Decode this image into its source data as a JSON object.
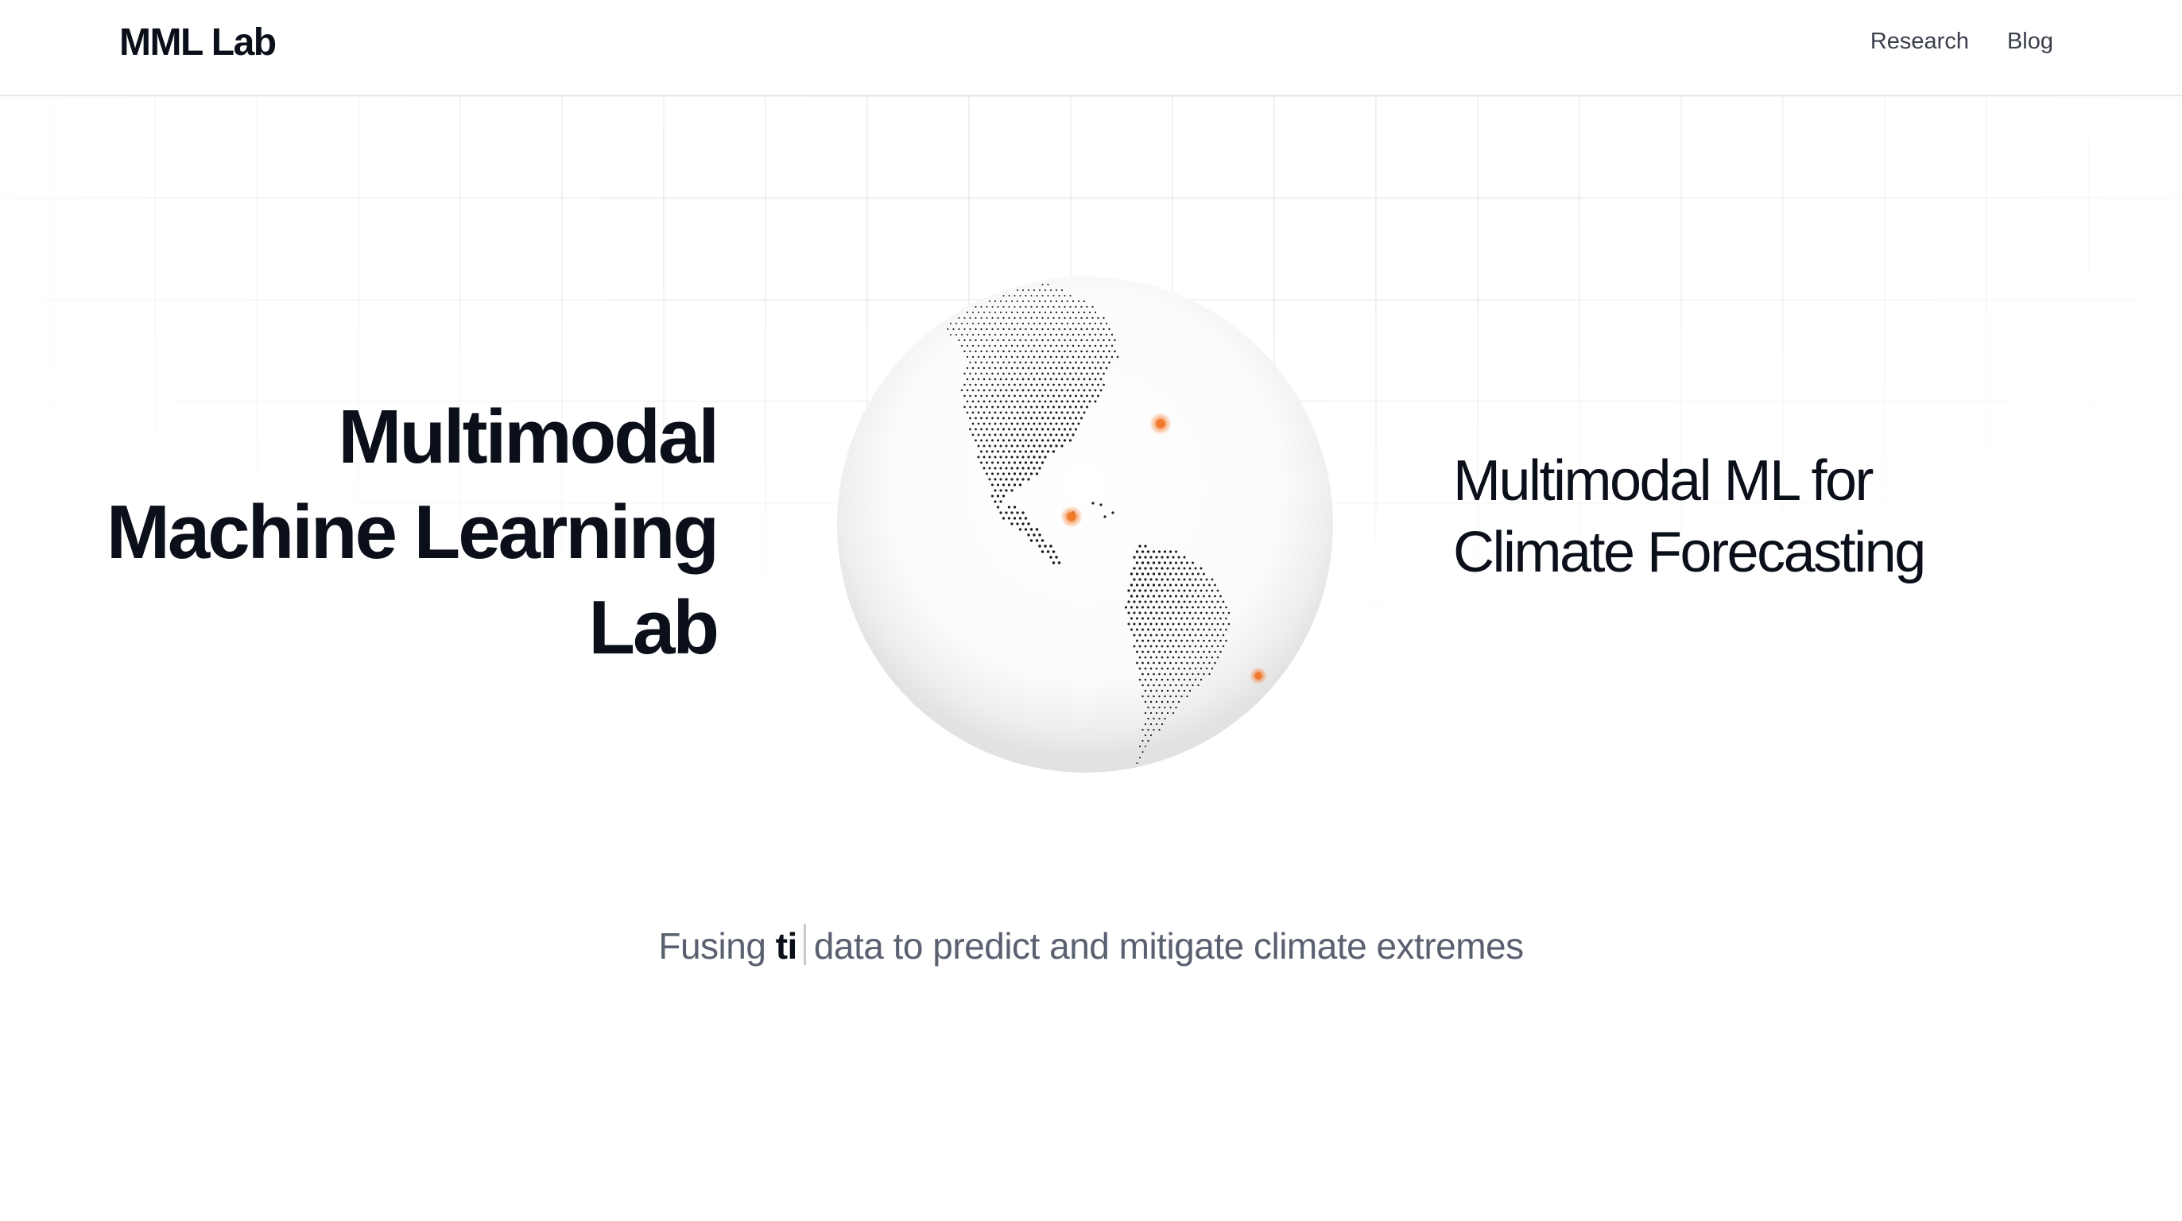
{
  "header": {
    "logo": "MML Lab",
    "nav": [
      {
        "label": "Research"
      },
      {
        "label": "Blog"
      }
    ]
  },
  "hero": {
    "title_lines": [
      "Multimodal",
      "Machine Learning",
      "Lab"
    ],
    "subtitle_lines": [
      "Multimodal ML for",
      "Climate Forecasting"
    ],
    "globe": {
      "accent_color": "#f27a2d",
      "dot_color": "#1a1a1a"
    }
  },
  "tagline": {
    "prefix": "Fusing ",
    "typed": "ti",
    "suffix": "data to predict and mitigate climate extremes"
  },
  "colors": {
    "text": "#0b0f19",
    "muted": "#5a6070",
    "accent": "#f27a2d"
  }
}
